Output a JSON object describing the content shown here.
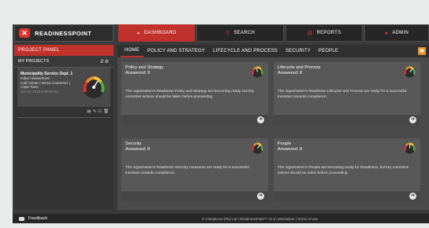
{
  "brand": {
    "name": "READINESSPOINT",
    "logo_icon": "x-logo-icon"
  },
  "nav": [
    {
      "label": "DASHBOARD",
      "icon": "dashboard-icon",
      "active": true
    },
    {
      "label": "SEARCH",
      "icon": "search-icon",
      "active": false
    },
    {
      "label": "REPORTS",
      "icon": "reports-icon",
      "active": false
    },
    {
      "label": "ADMIN",
      "icon": "admin-icon",
      "active": false
    }
  ],
  "left_panel": {
    "header": "PROJECT PANEL",
    "sub_header": "MY PROJECTS",
    "tools_icons": [
      "sort-icon",
      "settings-icon"
    ],
    "project": {
      "title": "Municipality Service Dept. 1",
      "line1": "Initial Assessment",
      "line2": "Call Center | Demo Customer |",
      "line3": "Cape Town",
      "date": "Jun 14, 2018 8:09:16 AM"
    }
  },
  "main": {
    "tabs": [
      "HOME",
      "POLICY AND STRATEGY",
      "LIFECYCLE AND PROCESS",
      "SECURITY",
      "PEOPLE"
    ],
    "active_tab": "HOME",
    "cards": [
      {
        "title": "Policy and Strategy",
        "answered": "Answered: 9",
        "desc": "The organisation's Readiness Policy and Strategy are becoming ready, but key corrective actions should be taken before proceeding."
      },
      {
        "title": "Lifecycle and Process",
        "answered": "Answered: 8",
        "desc": "The organisation's Readiness Lifecycle and Process are ready for a successful transition towards compliance."
      },
      {
        "title": "Security",
        "answered": "Answered: 8",
        "desc": "The organisation's Readiness Security measures are ready for a successful transition towards compliance."
      },
      {
        "title": "People",
        "answered": "Answered: 8",
        "desc": "The organisation's People are becoming ready for Readiness, but key corrective actions should be taken before proceeding."
      }
    ]
  },
  "footer": {
    "feedback": "Feedback",
    "copyright": "© Complexus (Pty) Ltd | ReadinessPoint™ V2.0 | Disclaimer | Terms of Use"
  },
  "colors": {
    "accent": "#c0312b",
    "flag": "#e5912d",
    "background": "#3a3a3a",
    "card": "#585858"
  }
}
